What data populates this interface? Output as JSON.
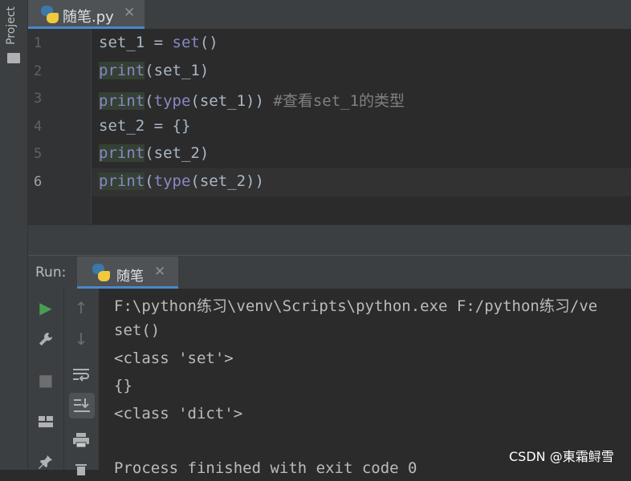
{
  "sidebar": {
    "project_label": "Project"
  },
  "editor_tab": {
    "title": "随笔.py",
    "close": "✕"
  },
  "editor": {
    "line_numbers": [
      "1",
      "2",
      "3",
      "4",
      "5",
      "6"
    ],
    "lines": [
      {
        "a": "set_1 = ",
        "b": "set",
        "c": "()"
      },
      {
        "kw": "print",
        "rest": "(set_1)"
      },
      {
        "kw": "print",
        "p1": "(",
        "kw2": "type",
        "p2": "(set_1)) ",
        "comment": "#查看set_1的类型"
      },
      {
        "text": "set_2 = {}"
      },
      {
        "kw": "print",
        "rest": "(set_2)"
      },
      {
        "kw": "print",
        "p1": "(",
        "kw2": "type",
        "p2": "(set_2))"
      }
    ]
  },
  "run_panel": {
    "label": "Run:",
    "tab_title": "随笔",
    "tab_close": "✕",
    "console_lines": [
      "F:\\python练习\\venv\\Scripts\\python.exe F:/python练习/ve",
      "set()",
      "<class 'set'>",
      "{}",
      "<class 'dict'>",
      "",
      "Process finished with exit code 0"
    ]
  },
  "watermark": "CSDN @東霜鲟雪",
  "colors": {
    "keyword": "#8888c6",
    "comment": "#808080",
    "accent": "#4a88c7",
    "run_green": "#499c54"
  }
}
